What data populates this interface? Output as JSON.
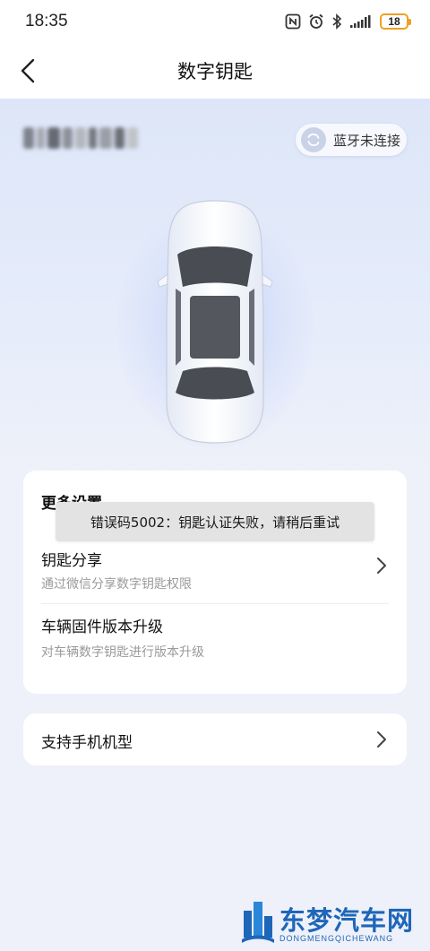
{
  "status_bar": {
    "time": "18:35",
    "battery": "18",
    "icons": [
      "nfc-icon",
      "alarm-icon",
      "bluetooth-icon",
      "signal-icon",
      "battery-icon"
    ]
  },
  "nav": {
    "title": "数字钥匙",
    "back_icon": "chevron-left-icon"
  },
  "vehicle": {
    "plate": "",
    "bluetooth_status": "蓝牙未连接",
    "bluetooth_icon": "refresh-icon"
  },
  "settings": {
    "title": "更多设置",
    "items": [
      {
        "label": "钥匙分享",
        "description": "通过微信分享数字钥匙权限",
        "has_chevron": true
      },
      {
        "label": "车辆固件版本升级",
        "description": "对车辆数字钥匙进行版本升级",
        "has_chevron": false
      }
    ]
  },
  "phones": {
    "label": "支持手机机型"
  },
  "toast": {
    "message": "错误码5002：钥匙认证失败，请稍后重试"
  },
  "watermark": {
    "name": "东梦汽车网",
    "domain": "DONGMENGQICHEWANG"
  },
  "colors": {
    "accent_blue": "#1e66b8",
    "battery_orange": "#f0a020",
    "background": "#eef1f9"
  }
}
